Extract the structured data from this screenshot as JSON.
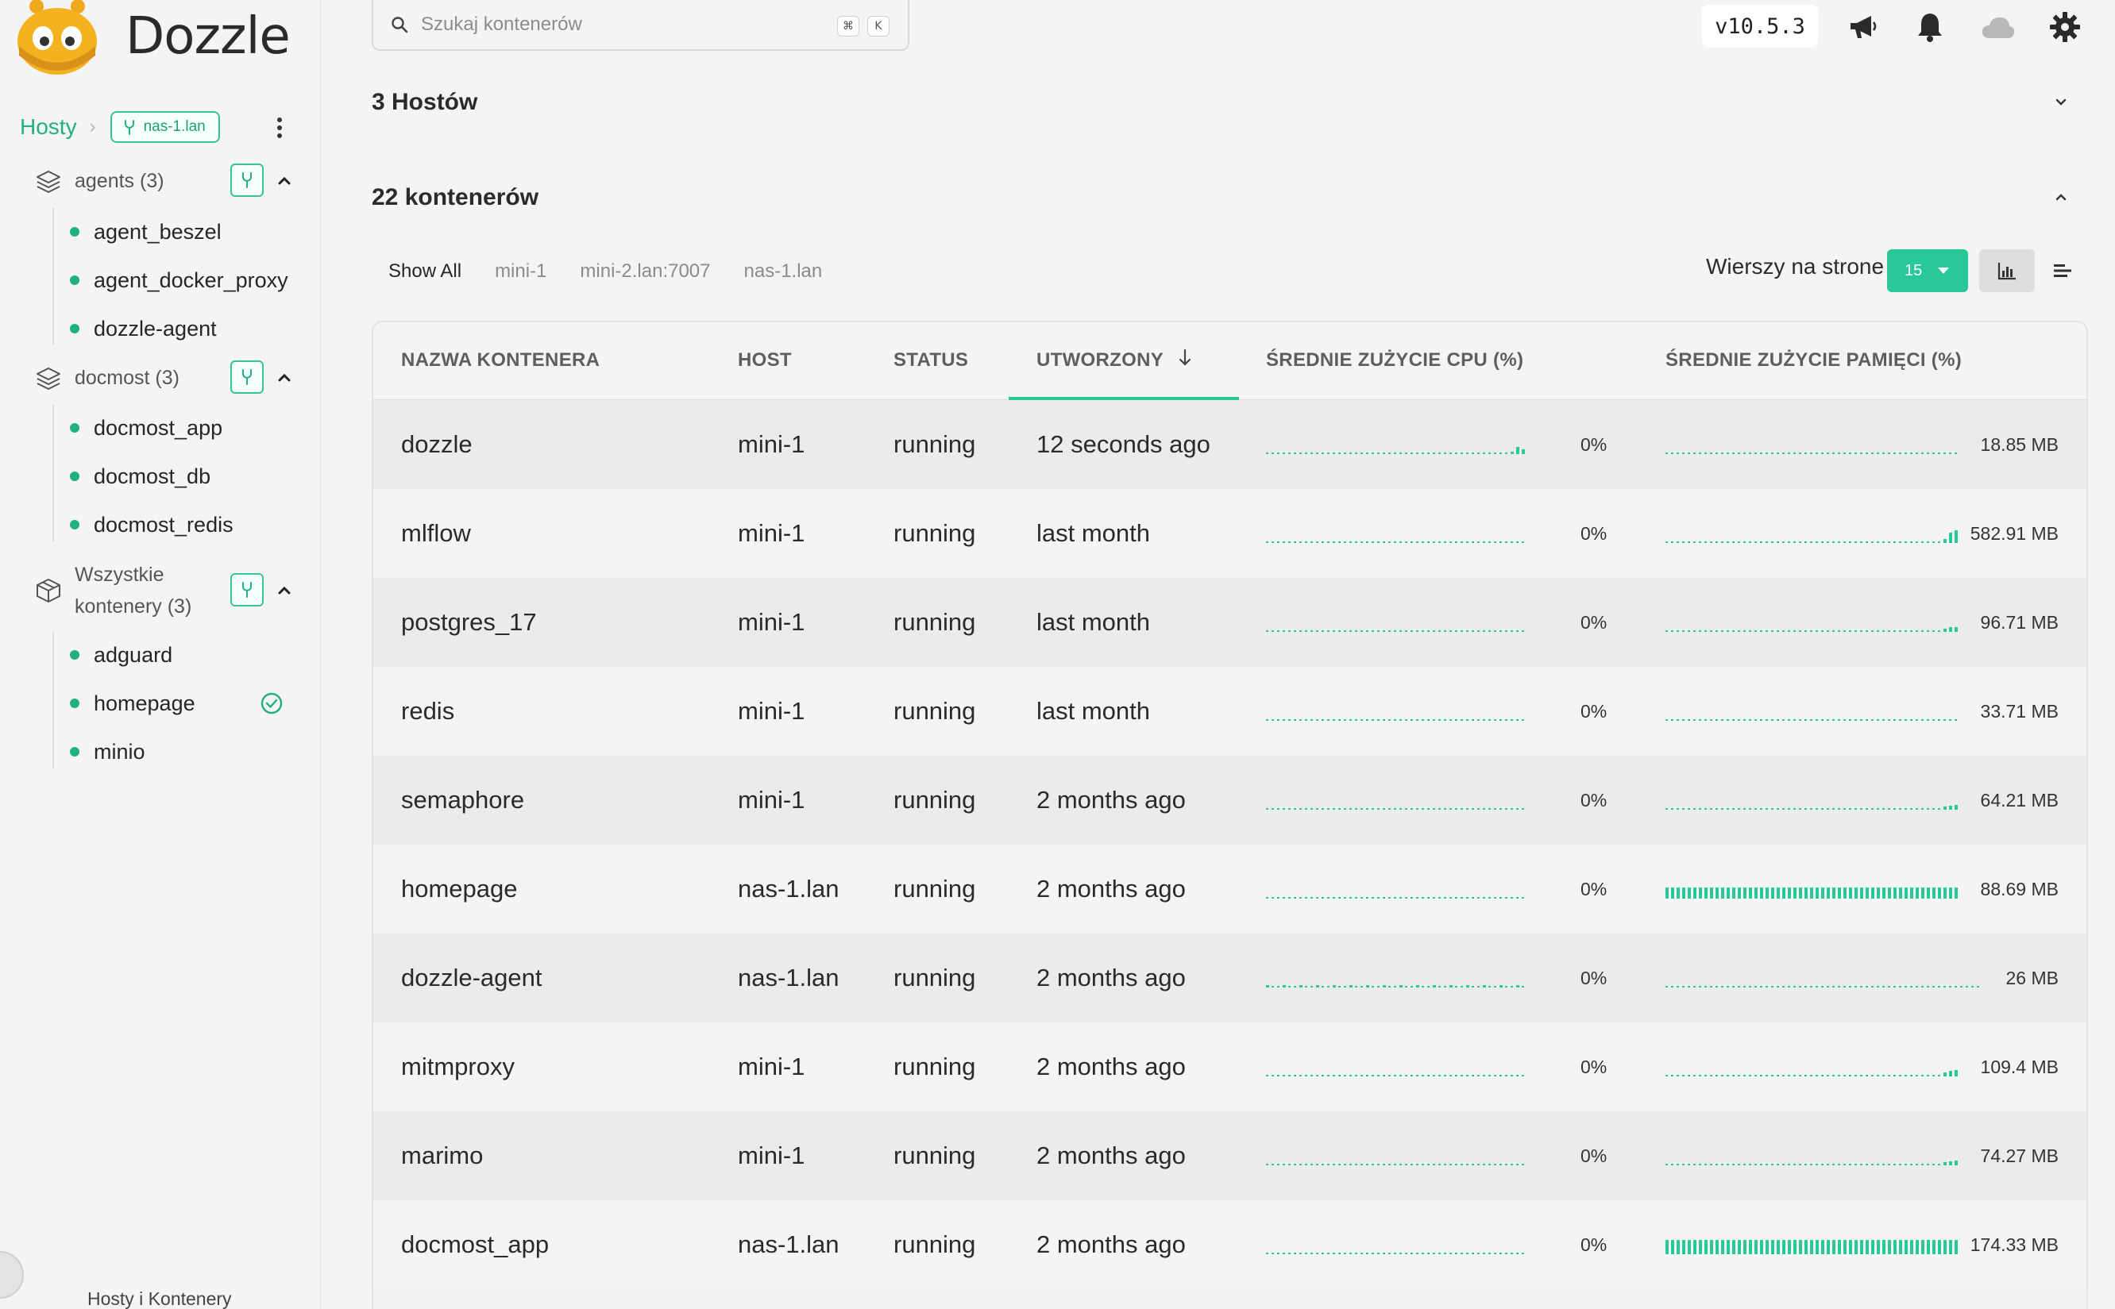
{
  "app": {
    "name": "Dozzle",
    "version": "v10.5.3"
  },
  "sidebar": {
    "breadcrumb_root": "Hosty",
    "current_host": "nas-1.lan",
    "footer": "Hosty i Kontenery",
    "groups": [
      {
        "label": "agents (3)",
        "items": [
          "agent_beszel",
          "agent_docker_proxy",
          "dozzle-agent"
        ]
      },
      {
        "label": "docmost (3)",
        "items": [
          "docmost_app",
          "docmost_db",
          "docmost_redis"
        ]
      },
      {
        "label_line1": "Wszystkie",
        "label_line2": "kontenery (3)",
        "items": [
          "adguard",
          "homepage",
          "minio"
        ]
      }
    ]
  },
  "search": {
    "placeholder": "Szukaj kontenerów",
    "key1": "⌘",
    "key2": "K"
  },
  "sections": {
    "hosts": "3 Hostów",
    "containers": "22 kontenerów"
  },
  "filters": [
    "Show All",
    "mini-1",
    "mini-2.lan:7007",
    "nas-1.lan"
  ],
  "pagination": {
    "label": "Wierszy na strone",
    "value": "15"
  },
  "table": {
    "headers": {
      "name": "NAZWA KONTENERA",
      "host": "HOST",
      "status": "STATUS",
      "created": "UTWORZONY",
      "cpu": "ŚREDNIE ZUŻYCIE CPU (%)",
      "mem": "ŚREDNIE ZUŻYCIE PAMIĘCI (%)"
    },
    "rows": [
      {
        "name": "dozzle",
        "host": "mini-1",
        "status": "running",
        "created": "12 seconds ago",
        "cpu": "0%",
        "mem": "18.85 MB",
        "cpu_tail": [
          3,
          9,
          6
        ],
        "mem_tail": [],
        "mem_level": 0
      },
      {
        "name": "mlflow",
        "host": "mini-1",
        "status": "running",
        "created": "last month",
        "cpu": "0%",
        "mem": "582.91 MB",
        "cpu_tail": [],
        "mem_tail": [
          5,
          13,
          16
        ],
        "mem_level": 0
      },
      {
        "name": "postgres_17",
        "host": "mini-1",
        "status": "running",
        "created": "last month",
        "cpu": "0%",
        "mem": "96.71 MB",
        "cpu_tail": [],
        "mem_tail": [
          4,
          6,
          6
        ],
        "mem_level": 0
      },
      {
        "name": "redis",
        "host": "mini-1",
        "status": "running",
        "created": "last month",
        "cpu": "0%",
        "mem": "33.71 MB",
        "cpu_tail": [],
        "mem_tail": [],
        "mem_level": 0
      },
      {
        "name": "semaphore",
        "host": "mini-1",
        "status": "running",
        "created": "2 months ago",
        "cpu": "0%",
        "mem": "64.21 MB",
        "cpu_tail": [],
        "mem_tail": [
          4,
          5,
          6
        ],
        "mem_level": 0
      },
      {
        "name": "homepage",
        "host": "nas-1.lan",
        "status": "running",
        "created": "2 months ago",
        "cpu": "0%",
        "mem": "88.69 MB",
        "cpu_tail": [],
        "mem_tail": [],
        "mem_level": 14
      },
      {
        "name": "dozzle-agent",
        "host": "nas-1.lan",
        "status": "running",
        "created": "2 months ago",
        "cpu": "0%",
        "mem": "26 MB",
        "cpu_tail": [],
        "mem_tail": [],
        "mem_level": 0,
        "cpu_dense": true
      },
      {
        "name": "mitmproxy",
        "host": "mini-1",
        "status": "running",
        "created": "2 months ago",
        "cpu": "0%",
        "mem": "109.4 MB",
        "cpu_tail": [],
        "mem_tail": [
          5,
          7,
          8
        ],
        "mem_level": 0
      },
      {
        "name": "marimo",
        "host": "mini-1",
        "status": "running",
        "created": "2 months ago",
        "cpu": "0%",
        "mem": "74.27 MB",
        "cpu_tail": [],
        "mem_tail": [
          4,
          5,
          6
        ],
        "mem_level": 0
      },
      {
        "name": "docmost_app",
        "host": "nas-1.lan",
        "status": "running",
        "created": "2 months ago",
        "cpu": "0%",
        "mem": "174.33 MB",
        "cpu_tail": [],
        "mem_tail": [],
        "mem_level": 18
      }
    ]
  },
  "colors": {
    "accent": "#28c997",
    "accent_dark": "#21b07f"
  }
}
